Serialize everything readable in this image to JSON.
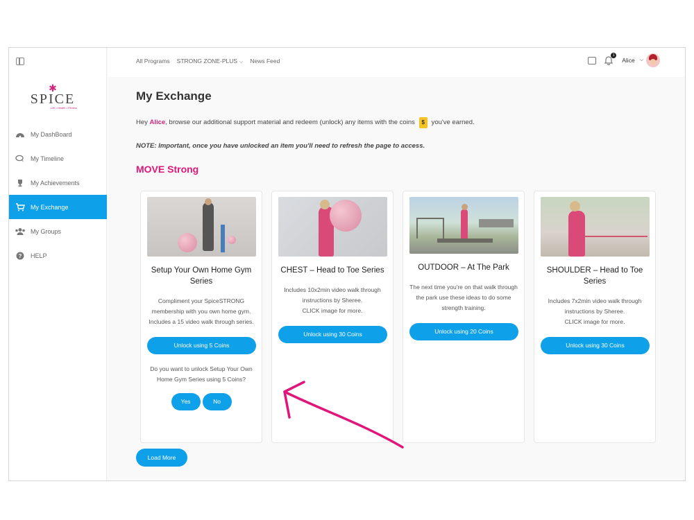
{
  "sidebar": {
    "logo": {
      "text": "SPICE",
      "tagline": "Life • Health • Fitness"
    },
    "items": [
      {
        "label": "My DashBoard",
        "icon": "dashboard-icon"
      },
      {
        "label": "My Timeline",
        "icon": "timeline-icon"
      },
      {
        "label": "My Achievements",
        "icon": "trophy-icon"
      },
      {
        "label": "My Exchange",
        "icon": "cart-icon",
        "active": true
      },
      {
        "label": "My Groups",
        "icon": "groups-icon"
      },
      {
        "label": "HELP",
        "icon": "help-icon"
      }
    ]
  },
  "header": {
    "nav": [
      "All Programs",
      "STRONG ZONE-PLUS",
      "News Feed"
    ],
    "notifications": "1",
    "user": "Alice"
  },
  "main": {
    "title": "My Exchange",
    "intro_prefix": "Hey",
    "intro_name": "Alice",
    "intro_mid": ", browse our additional support material and redeem (unlock) any items with the coins",
    "coin_symbol": "$",
    "intro_suffix": "you've earned.",
    "note": "NOTE: Important, once you have unlocked an item you'll need to refresh the page to access.",
    "section": "MOVE Strong",
    "cards": [
      {
        "title": "Setup Your Own Home Gym Series",
        "desc": "Compliment your SpiceSTRONG membership with you own home gym. Includes a 15 video walk through series.",
        "button": "Unlock using 5 Coins",
        "confirm": "Do you want to unlock Setup Your Own Home Gym Series using 5 Coins?",
        "yes": "Yes",
        "no": "No"
      },
      {
        "title": "CHEST – Head to Toe Series",
        "desc": "Includes 10x2min video walk through instructions by Sheree.\nCLICK image for more.",
        "button": "Unlock using 30 Coins"
      },
      {
        "title": "OUTDOOR – At The Park",
        "desc": "The next time you're on that walk through the park use these ideas to do some strength training.",
        "button": "Unlock using 20 Coins"
      },
      {
        "title": "SHOULDER – Head to Toe Series",
        "desc": "Includes 7x2min video walk through instructions by Sheree.\nCLICK image for more.",
        "button": "Unlock using 30 Coins"
      }
    ],
    "load_more": "Load More"
  },
  "colors": {
    "accent": "#0fa0ea",
    "brand": "#e0167a",
    "coin": "#f6c326"
  }
}
